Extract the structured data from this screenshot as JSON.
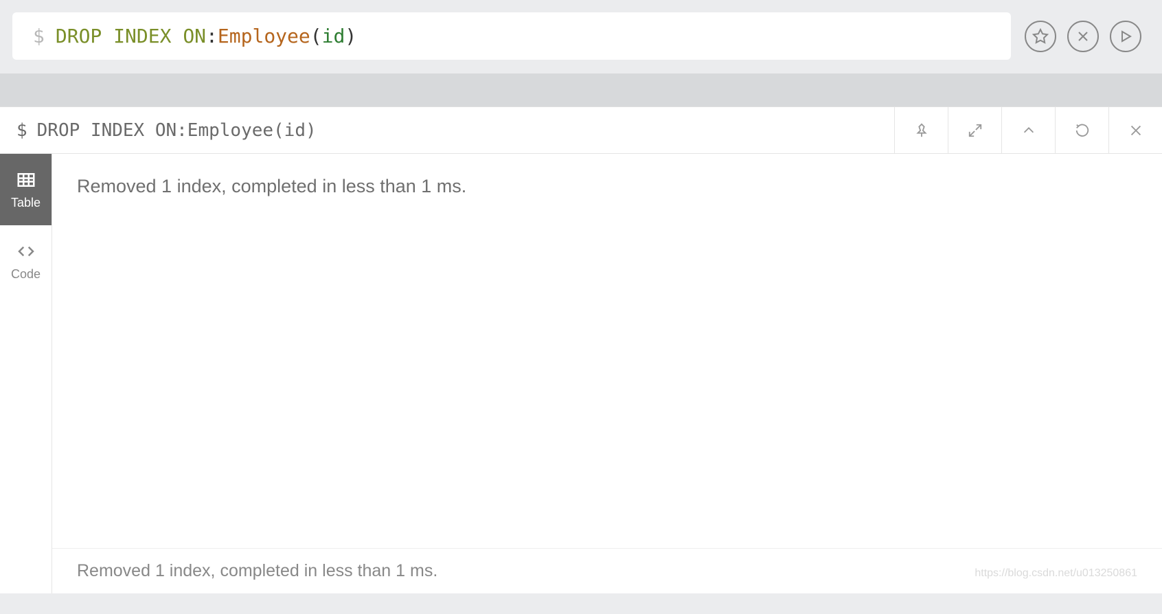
{
  "editor": {
    "prompt": "$",
    "tokens": {
      "drop": "DROP",
      "index": "INDEX",
      "on": "ON",
      "colon": ":",
      "label": "Employee",
      "lparen": "(",
      "field": "id",
      "rparen": ")"
    }
  },
  "result": {
    "prompt": "$",
    "query_text": "DROP INDEX ON:Employee(id)",
    "message": "Removed 1 index, completed in less than 1 ms.",
    "footer_message": "Removed 1 index, completed in less than 1 ms."
  },
  "tabs": {
    "table": "Table",
    "code": "Code"
  },
  "watermark": "https://blog.csdn.net/u013250861"
}
